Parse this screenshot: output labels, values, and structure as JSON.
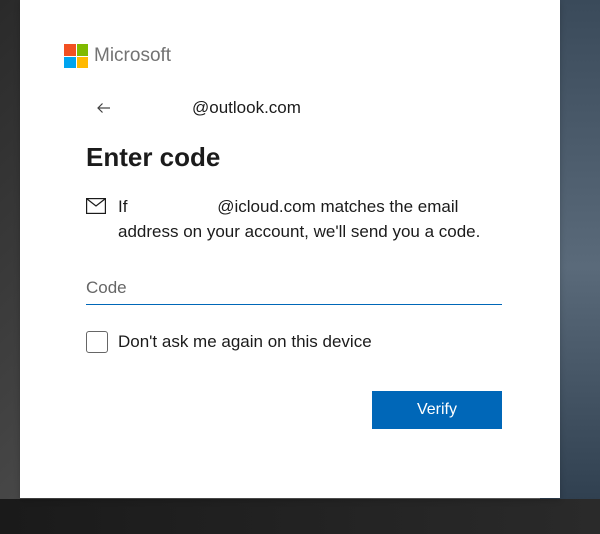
{
  "brand": {
    "name": "Microsoft"
  },
  "identity": {
    "email_suffix": "@outlook.com"
  },
  "heading": "Enter code",
  "instruction": {
    "prefix": "If",
    "domain_suffix": "@icloud.com matches the email address on your account, we'll send you a code."
  },
  "input": {
    "placeholder": "Code"
  },
  "checkbox": {
    "label": "Don't ask me again on this device"
  },
  "actions": {
    "verify": "Verify"
  }
}
